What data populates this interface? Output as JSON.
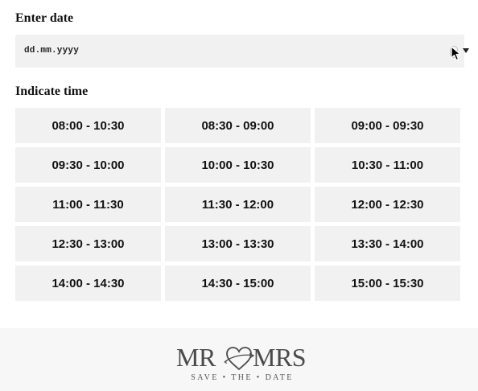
{
  "date_section": {
    "label": "Enter date",
    "input_value": "dd.mm.yyyy"
  },
  "time_section": {
    "label": "Indicate time",
    "slots": [
      "08:00 - 10:30",
      "08:30 - 09:00",
      "09:00 - 09:30",
      "09:30 - 10:00",
      "10:00 - 10:30",
      "10:30 - 11:00",
      "11:00 - 11:30",
      "11:30 - 12:00",
      "12:00 - 12:30",
      "12:30 - 13:00",
      "13:00 - 13:30",
      "13:30 - 14:00",
      "14:00 - 14:30",
      "14:30 - 15:00",
      "15:00 - 15:30"
    ]
  },
  "footer": {
    "logo_left": "MR",
    "logo_right": "MRS",
    "logo_tagline": "SAVE • THE • DATE"
  },
  "colors": {
    "field_background": "#f1f1f1",
    "footer_background": "#f7f7f7",
    "logo_text": "#4a4a4a"
  },
  "icons": {
    "date_spinner": "spinner-icon",
    "date_dropdown": "dropdown-arrow-icon",
    "pointer": "mouse-cursor-icon",
    "logo_mark": "heart-icon"
  }
}
